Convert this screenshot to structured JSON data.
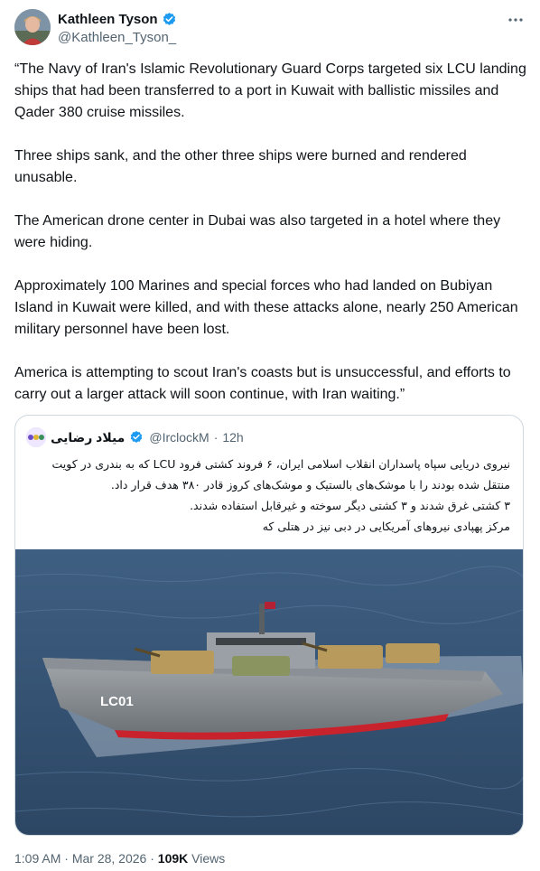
{
  "tweet": {
    "author_name": "Kathleen Tyson",
    "author_handle": "@Kathleen_Tyson_",
    "paragraphs": [
      "“The Navy of Iran's Islamic Revolutionary Guard Corps targeted six LCU landing ships that had been transferred to a port in Kuwait with ballistic missiles and Qader 380 cruise missiles.",
      "Three ships sank, and the other three ships were burned and rendered unusable.",
      "The American drone center in Dubai was also targeted in a hotel where they were hiding.",
      "Approximately 100 Marines and special forces who had landed on Bubiyan Island in Kuwait were killed, and with these attacks alone, nearly 250 American military personnel have been lost.",
      "America is attempting to scout Iran's coasts but is unsuccessful, and efforts to carry out a larger attack will soon continue, with Iran waiting.”"
    ],
    "time": "1:09 AM",
    "date": "Mar 28, 2026",
    "views_count": "109K",
    "views_label": "Views",
    "separator": "·"
  },
  "quote": {
    "author_name": "میلاد رضایی",
    "author_handle": "@IrclockM",
    "age": "12h",
    "separator": "·",
    "lines": [
      "نیروی دریایی سپاه پاسداران انقلاب اسلامی ایران، ۶ فروند کشتی فرود LCU که به بندری در کویت",
      "منتقل شده بودند را با موشک‌های بالستیک و موشک‌های کروز قادر ۳۸۰ هدف قرار داد.",
      "۳ کشتی غرق شدند و ۳ کشتی دیگر سوخته و غیرقابل استفاده شدند.",
      "مرکز پهپادی نیروهای آمریکایی در دبی نیز در هتلی که"
    ],
    "image_hull_label": "LC01"
  },
  "colors": {
    "verified": "#1d9bf0",
    "text": "#0f1419",
    "muted": "#536471",
    "border": "#cfd9de",
    "sea": "#4a6a8c"
  },
  "icons": {
    "verified": "verified-badge-icon",
    "more": "more-horizontal-icon"
  }
}
